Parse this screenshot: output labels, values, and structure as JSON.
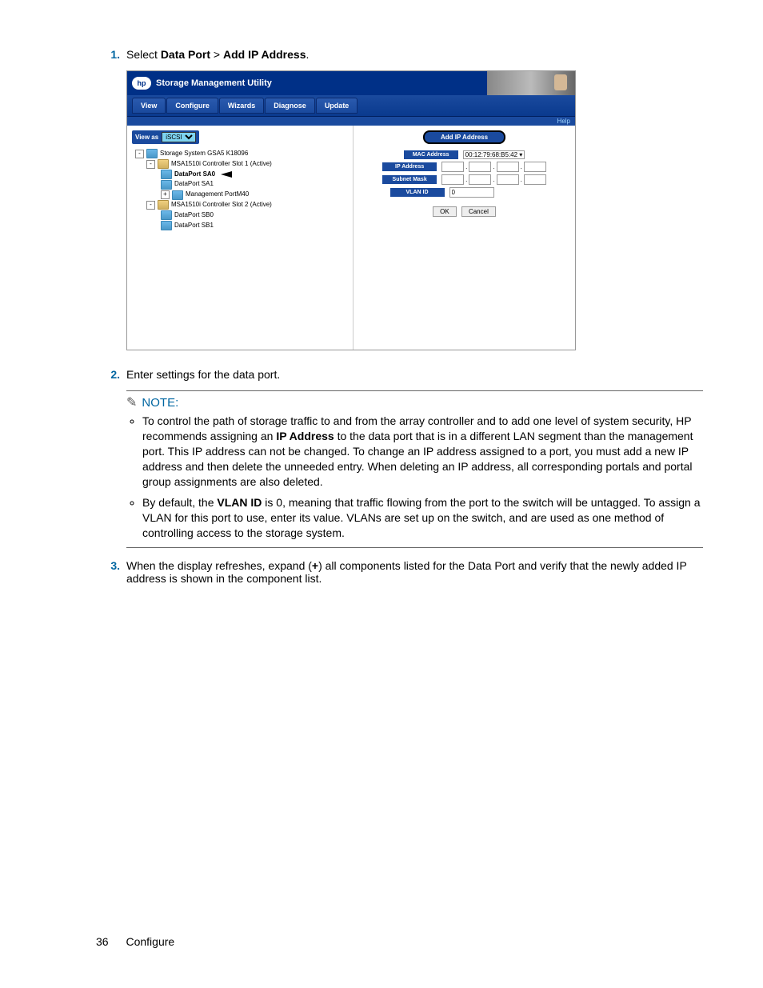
{
  "steps": {
    "s1": {
      "num": "1.",
      "text_pre": "Select ",
      "b1": "Data Port",
      "mid": " > ",
      "b2": "Add IP Address",
      "text_post": "."
    },
    "s2": {
      "num": "2.",
      "text": "Enter settings for the data port."
    },
    "s3": {
      "num": "3.",
      "t1": "When the display refreshes, expand (",
      "b1": "+",
      "t2": ") all components listed for the Data Port and verify that the newly added IP address is shown in the component list."
    }
  },
  "app": {
    "title": "Storage Management Utility",
    "menu": [
      "View",
      "Configure",
      "Wizards",
      "Diagnose",
      "Update"
    ],
    "help": "Help",
    "view_as_label": "View as",
    "view_as_value": "iSCSI",
    "tree": {
      "root": "Storage System GSA5 K18096",
      "c1": "MSA1510i Controller Slot 1 (Active)",
      "p1a": "DataPort SA0",
      "p1b": "DataPort SA1",
      "p1c": "Management PortM40",
      "c2": "MSA1510i Controller Slot 2 (Active)",
      "p2a": "DataPort SB0",
      "p2b": "DataPort SB1"
    },
    "panel": {
      "title": "Add IP Address",
      "mac_label": "MAC Address",
      "mac_value": "00:12:79:68:B5:42",
      "ip_label": "IP Address",
      "mask_label": "Subnet Mask",
      "vlan_label": "VLAN ID",
      "vlan_value": "0",
      "ok": "OK",
      "cancel": "Cancel"
    }
  },
  "note": {
    "title": "NOTE:",
    "b1": {
      "t1": "To control the path of storage traffic to and from the array controller and to add one level of system security, HP recommends assigning an ",
      "bold1": "IP Address",
      "t2": " to the data port that is in a different LAN segment than the management port. This IP address can not be changed. To change an IP address assigned to a port, you must add a new IP address and then delete the unneeded entry. When deleting an IP address, all corresponding portals and portal group assignments are also deleted."
    },
    "b2": {
      "t1": "By default, the ",
      "bold1": "VLAN ID",
      "t2": " is 0, meaning that traffic flowing from the port to the switch will be untagged. To assign a VLAN for this port to use, enter its value. VLANs are set up on the switch, and are used as one method of controlling access to the storage system."
    }
  },
  "footer": {
    "page": "36",
    "section": "Configure"
  }
}
